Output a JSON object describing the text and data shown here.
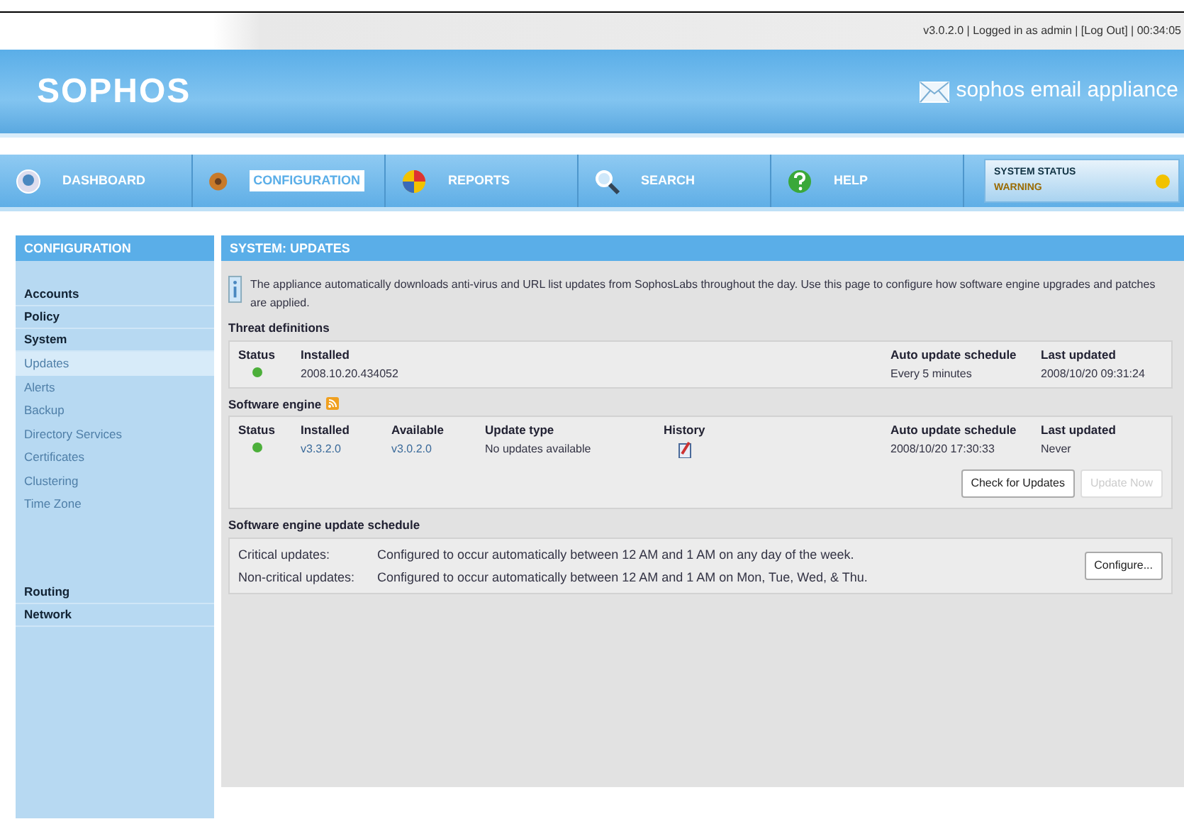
{
  "top_bar": {
    "info": "v3.0.2.0 | Logged in as admin | [Log Out] | 00:34:05"
  },
  "banner": {
    "logo": "SOPHOS",
    "product": "sophos email appliance"
  },
  "nav": [
    {
      "label": "DASHBOARD",
      "selected": false
    },
    {
      "label": "CONFIGURATION",
      "selected": true
    },
    {
      "label": "REPORTS",
      "selected": false
    },
    {
      "label": "SEARCH",
      "selected": false
    },
    {
      "label": "HELP",
      "selected": false
    }
  ],
  "system_status": {
    "label": "SYSTEM STATUS",
    "value": "WARNING",
    "color": "#f2c200"
  },
  "sidebar": {
    "title": "CONFIGURATION",
    "items": [
      {
        "label": "Accounts",
        "kind": "section",
        "selected": false
      },
      {
        "label": "Policy",
        "kind": "section",
        "selected": false
      },
      {
        "label": "System",
        "kind": "section",
        "selected": false,
        "children": [
          {
            "label": "Updates",
            "selected": true
          },
          {
            "label": "Alerts",
            "selected": false
          },
          {
            "label": "Backup",
            "selected": false
          },
          {
            "label": "Directory Services",
            "selected": false
          },
          {
            "label": "Certificates",
            "selected": false
          },
          {
            "label": "Clustering",
            "selected": false
          },
          {
            "label": "Time Zone",
            "selected": false
          }
        ]
      },
      {
        "label": "Routing",
        "kind": "section",
        "selected": false,
        "gap": true
      },
      {
        "label": "Network",
        "kind": "section",
        "selected": false
      }
    ]
  },
  "page": {
    "title": "SYSTEM: UPDATES",
    "info": "The appliance automatically downloads anti-virus and URL list updates from SophosLabs throughout the day. Use this page to configure how software engine upgrades and patches are applied.",
    "threat_definitions": {
      "heading": "Threat definitions",
      "columns": [
        "Status",
        "Installed",
        "Auto update schedule",
        "Last updated"
      ],
      "row": {
        "color": "#4caf3a",
        "installed": "2008.10.20.434052",
        "schedule": "Every 5 minutes",
        "last_updated": "2008/10/20 09:31:24"
      }
    },
    "software_engine": {
      "heading": "Software engine",
      "columns": [
        "Status",
        "Installed",
        "Available",
        "Update type",
        "History",
        "Auto update schedule",
        "Last updated"
      ],
      "row": {
        "color": "#4caf3a",
        "installed": "v3.3.2.0",
        "available": "v3.0.2.0",
        "update_type": "No updates available",
        "schedule": "2008/10/20 17:30:33",
        "last_updated": "Never"
      },
      "buttons": [
        {
          "label": "Check for Updates",
          "disabled": false
        },
        {
          "label": "Update Now",
          "disabled": true
        }
      ]
    },
    "schedule": {
      "heading": "Software engine update schedule",
      "rows": [
        {
          "label": "Critical updates:",
          "text": "Configured to occur automatically between 12 AM and 1 AM on any day of the week."
        },
        {
          "label": "Non-critical updates:",
          "text": "Configured to occur automatically between 12 AM and 1 AM on Mon, Tue, Wed, & Thu."
        }
      ],
      "button": "Configure..."
    }
  }
}
